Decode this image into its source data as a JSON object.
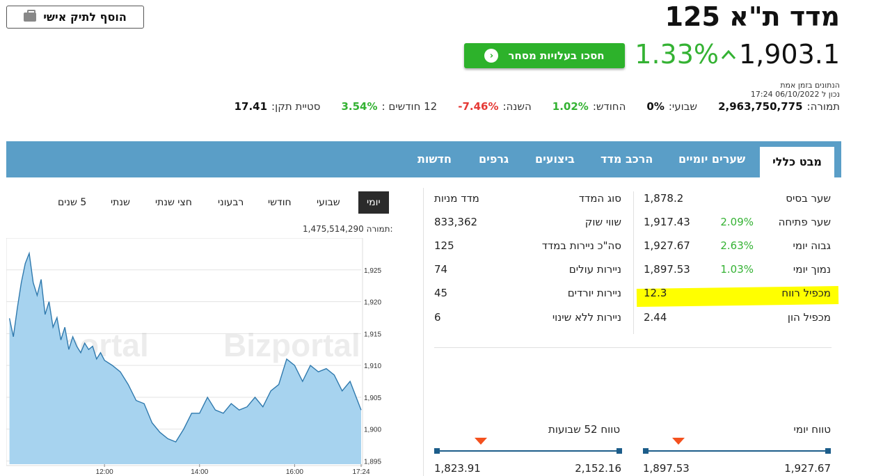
{
  "header": {
    "title": "מדד ת\"א 125",
    "add_portfolio_label": "הוסף לתיק אישי",
    "price": "1,903.1",
    "change": "1.33%",
    "trade_button_label": "חסכו בעלויות מסחר",
    "realtime_label": "הנתונים בזמן אמת",
    "updated_label": "נכון ל 06/10/2022 17:24"
  },
  "stats": [
    {
      "label": "תמורה:",
      "value": "2,963,750,775",
      "tone": "neutral"
    },
    {
      "label": "שבועי:",
      "value": "0%",
      "tone": "neutral"
    },
    {
      "label": "החודש:",
      "value": "1.02%",
      "tone": "pos"
    },
    {
      "label": "השנה:",
      "value": "-7.46%",
      "tone": "neg"
    },
    {
      "label": "12 חודשים :",
      "value": "3.54%",
      "tone": "pos"
    },
    {
      "label": "סטיית תקן:",
      "value": "17.41",
      "tone": "neutral"
    }
  ],
  "tabs": [
    "מבט כללי",
    "שערים יומיים",
    "הרכב מדד",
    "ביצועים",
    "גרפים",
    "חדשות"
  ],
  "active_tab": "מבט כללי",
  "ranges": [
    "יומי",
    "שבועי",
    "חודשי",
    "רבעוני",
    "חצי שנתי",
    "שנתי",
    "5 שנים"
  ],
  "active_range": "יומי",
  "chart_volume_label": "תמורה:",
  "chart_volume_value": "1,475,514,290",
  "watermark": "Bizportal",
  "left_table": [
    {
      "label": "שער בסיס",
      "value": "1,878.2",
      "pct": ""
    },
    {
      "label": "שער פתיחה",
      "value": "1,917.43",
      "pct": "2.09%"
    },
    {
      "label": "גבוה יומי",
      "value": "1,927.67",
      "pct": "2.63%"
    },
    {
      "label": "נמוך יומי",
      "value": "1,897.53",
      "pct": "1.03%"
    },
    {
      "label": "מכפיל רווח",
      "value": "12.3",
      "pct": ""
    },
    {
      "label": "מכפיל הון",
      "value": "2.44",
      "pct": ""
    }
  ],
  "right_table": [
    {
      "label": "סוג המדד",
      "value": "מדד מניות"
    },
    {
      "label": "שווי שוק",
      "value": "833,362"
    },
    {
      "label": "סה\"כ ניירות במדד",
      "value": "125"
    },
    {
      "label": "ניירות עולים",
      "value": "74"
    },
    {
      "label": "ניירות יורדים",
      "value": "45"
    },
    {
      "label": "ניירות ללא שינוי",
      "value": "6"
    }
  ],
  "daily_range": {
    "label": "טווח יומי",
    "low": "1,897.53",
    "high": "1,927.67",
    "marker_fraction": 0.18
  },
  "week52_range": {
    "label": "טווח 52 שבועות",
    "low": "1,823.91",
    "high": "2,152.16",
    "marker_fraction": 0.24
  },
  "chart_data": {
    "type": "area",
    "x_ticks": [
      "12:00",
      "14:00",
      "16:00",
      "17:24"
    ],
    "y_ticks": [
      "1,925",
      "1,920",
      "1,915",
      "1,910",
      "1,905",
      "1,900",
      "1,895"
    ],
    "ylim": [
      1894.5,
      1930
    ],
    "x": [
      "10:00",
      "10:05",
      "10:10",
      "10:15",
      "10:20",
      "10:25",
      "10:30",
      "10:35",
      "10:40",
      "10:45",
      "10:50",
      "10:55",
      "11:00",
      "11:05",
      "11:10",
      "11:15",
      "11:20",
      "11:25",
      "11:30",
      "11:35",
      "11:40",
      "11:45",
      "11:50",
      "11:55",
      "12:00",
      "12:10",
      "12:20",
      "12:30",
      "12:40",
      "12:50",
      "13:00",
      "13:10",
      "13:20",
      "13:30",
      "13:40",
      "13:50",
      "14:00",
      "14:10",
      "14:20",
      "14:30",
      "14:40",
      "14:50",
      "15:00",
      "15:10",
      "15:20",
      "15:30",
      "15:40",
      "15:50",
      "16:00",
      "16:10",
      "16:20",
      "16:30",
      "16:40",
      "16:50",
      "17:00",
      "17:10",
      "17:24"
    ],
    "values": [
      1917.4,
      1914.5,
      1919,
      1923,
      1926,
      1927.6,
      1923,
      1921,
      1923.5,
      1918,
      1920,
      1916,
      1917.5,
      1914,
      1916,
      1912.5,
      1914.5,
      1913,
      1912,
      1913.5,
      1912.5,
      1913,
      1911,
      1912,
      1910.8,
      1910,
      1909,
      1907,
      1904.5,
      1904,
      1901,
      1899.5,
      1898.5,
      1898,
      1900,
      1902.5,
      1902.5,
      1905,
      1903,
      1902.5,
      1904,
      1903,
      1903.5,
      1905,
      1903.5,
      1906,
      1907,
      1911,
      1910,
      1907.5,
      1910,
      1909,
      1909.5,
      1908.5,
      1906,
      1907.5,
      1903
    ]
  }
}
